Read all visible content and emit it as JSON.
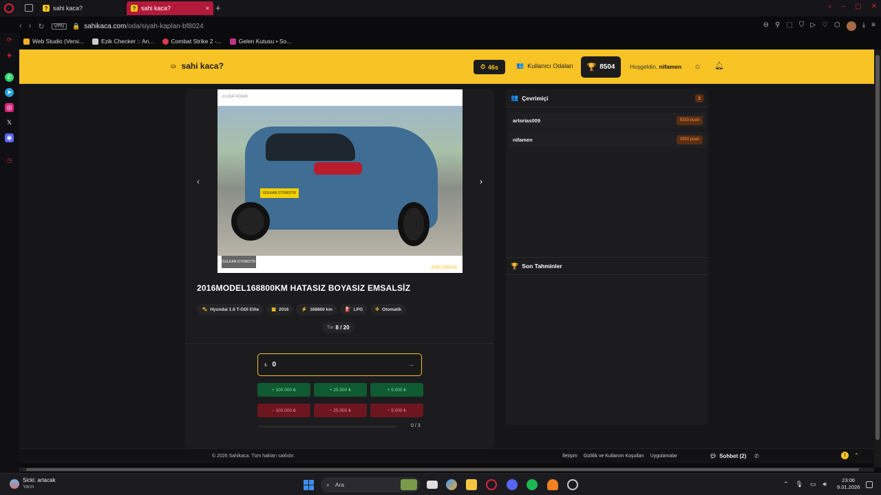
{
  "browser": {
    "tabs": [
      {
        "label": "sahi kaca?",
        "favicon": "?"
      },
      {
        "label": "sahi kaca?",
        "favicon": "?"
      }
    ],
    "url_host": "sahikaca.com",
    "url_path": "/oda/siyah-kaplan-bf8024",
    "vpn_label": "VPN",
    "bookmarks": [
      {
        "label": "Web Studio (Versi...",
        "color": "#f2b01e"
      },
      {
        "label": "Ezik Checker :: An...",
        "color": "#cccccc"
      },
      {
        "label": "Combat Strike 2 -...",
        "color": "#e2384d"
      },
      {
        "label": "Gelen Kutusu • So...",
        "color": "#c1358f"
      }
    ]
  },
  "header": {
    "brand": "sahi kaca?",
    "timer": "46s",
    "rooms_link": "Kullanıcı Odaları",
    "score": "8504",
    "welcome_prefix": "Hoşgeldin,",
    "username": "nifamen"
  },
  "listing": {
    "photo_id": "#1284743848",
    "plate_text": "GÜLKAN OTOMOTİV",
    "dealer_logo": "GÜLKAN OTOMOTİV",
    "ref_code": "#35154636",
    "title": "2016MODEL168800KM HATASIZ BOYASIZ EMSALSİZ",
    "specs": [
      {
        "icon": "car-icon",
        "glyph": "⛍",
        "label": "Hyundai 1.6 T-GDI Elite"
      },
      {
        "icon": "calendar-icon",
        "glyph": "▦",
        "label": "2016"
      },
      {
        "icon": "speed-icon",
        "glyph": "⚡",
        "label": "168800 km"
      },
      {
        "icon": "fuel-icon",
        "glyph": "⛽",
        "label": "LPG"
      },
      {
        "icon": "gear-icon",
        "glyph": "✣",
        "label": "Otomatik"
      }
    ],
    "round_label": "Tur",
    "round_value": "8 / 20"
  },
  "guess": {
    "currency": "₺",
    "value": "0",
    "progress_fraction": 0.0,
    "attempts": "0 / 3",
    "plus_buttons": [
      "+ 100.000 ₺",
      "+ 25.000 ₺",
      "+ 5.000 ₺"
    ],
    "minus_buttons": [
      "− 100.000 ₺",
      "− 25.000 ₺",
      "− 5.000 ₺"
    ]
  },
  "online": {
    "title": "Çevrimiçi",
    "count": "2",
    "players": [
      {
        "name": "artorias009",
        "points": "5333 puan"
      },
      {
        "name": "nifamen",
        "points": "2930 puan"
      }
    ]
  },
  "recent": {
    "title": "Son Tahminler"
  },
  "footer": {
    "copyright": "© 2026 Sahikaca. Tüm hakları saklıdır.",
    "links": [
      "İletişim",
      "Gizlilik ve Kullanım Koşulları",
      "Uygulamalar"
    ],
    "chat": "Sohbet (2)"
  },
  "taskbar": {
    "weather_title": "Sickl. artacak",
    "weather_sub": "Yarın",
    "search": "Ara",
    "time": "23:06",
    "date": "9.01.2026"
  },
  "colors": {
    "accent": "#f7c325",
    "plus": "#0f5a31",
    "minus": "#6d1620"
  }
}
